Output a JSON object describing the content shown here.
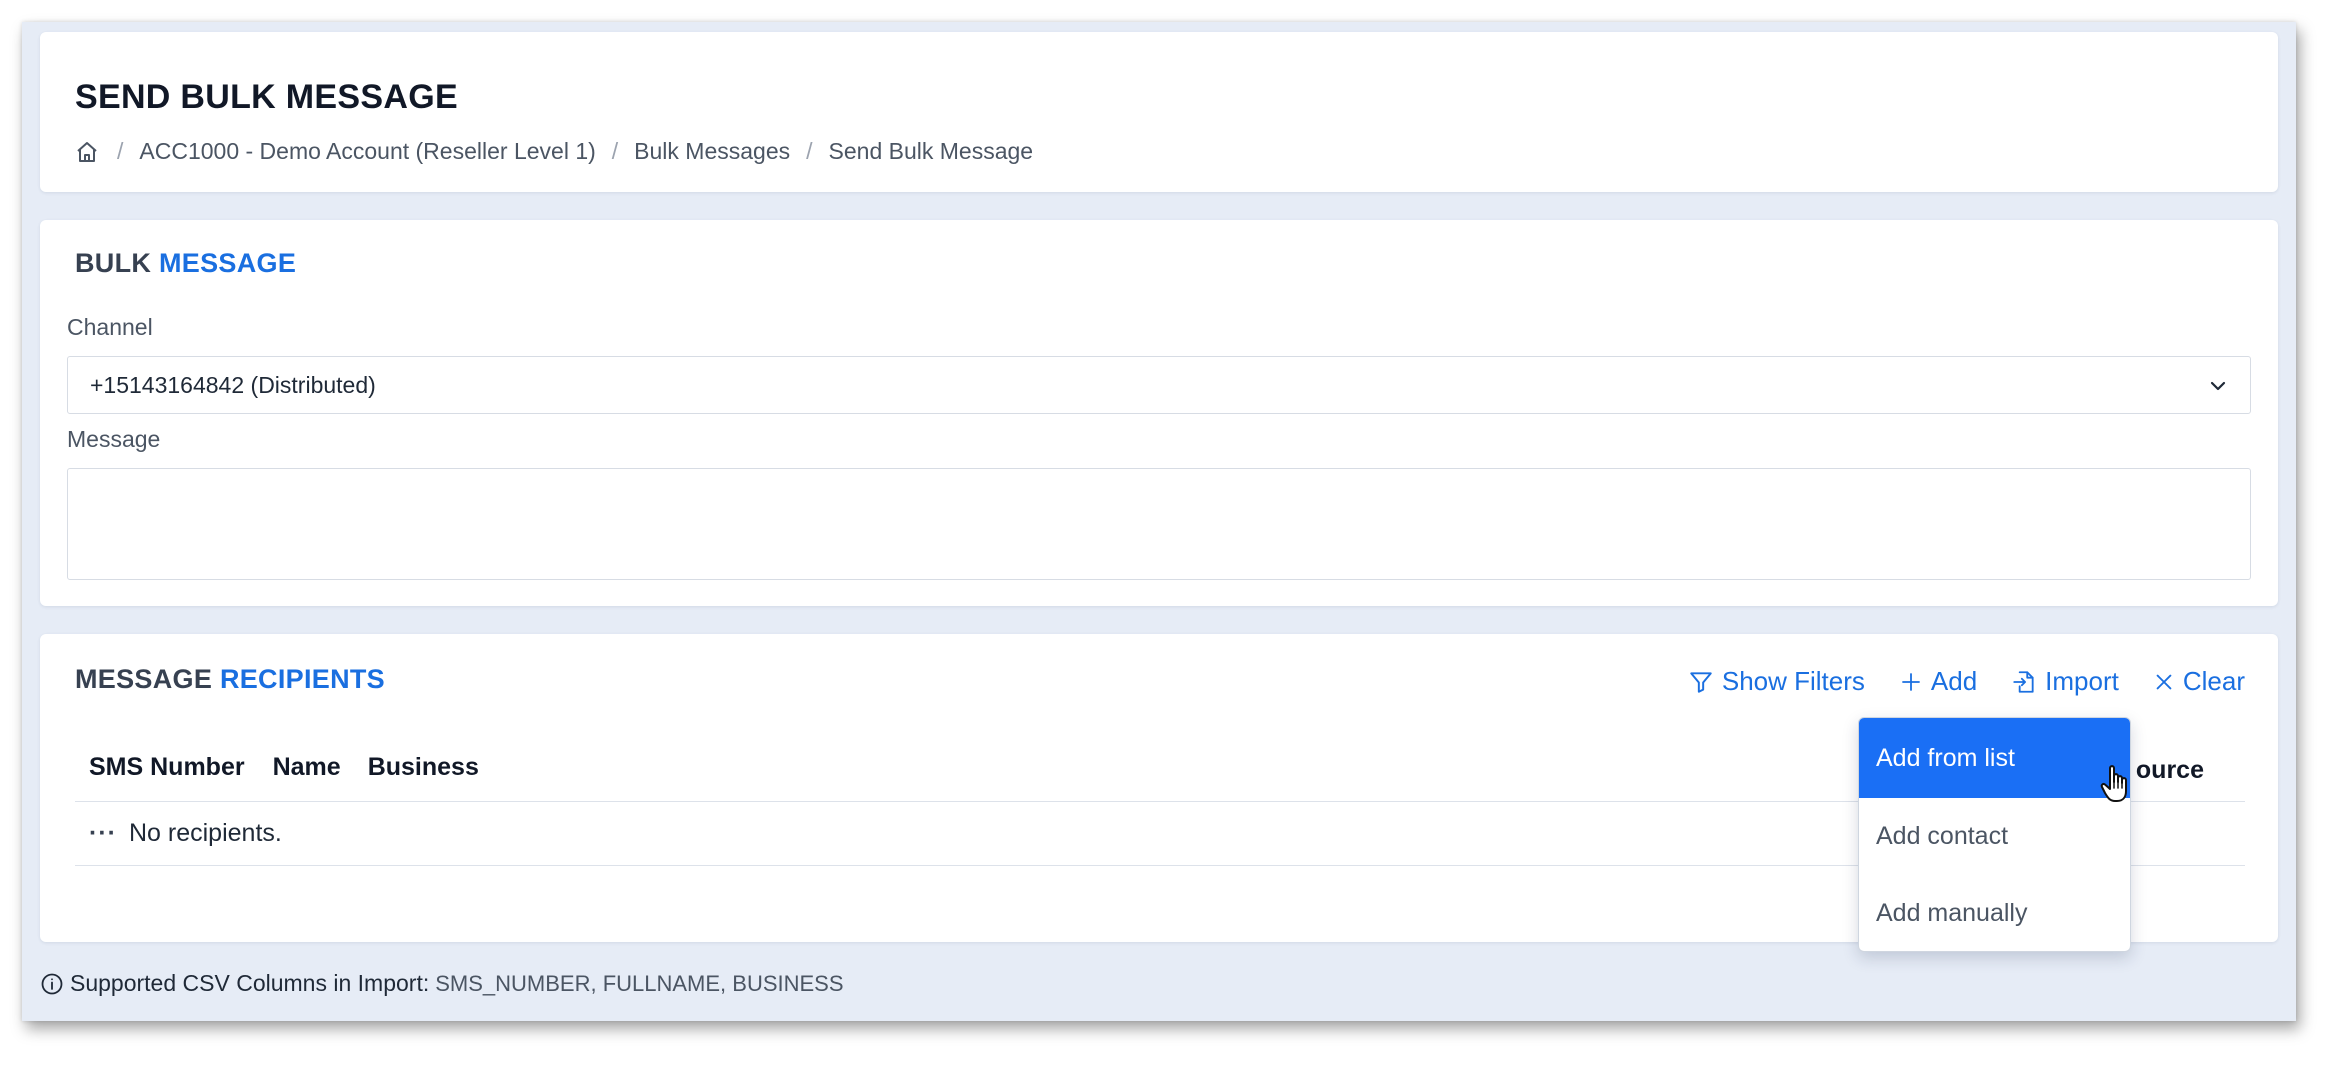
{
  "header": {
    "title": "SEND BULK MESSAGE",
    "breadcrumb": [
      "ACC1000 - Demo Account (Reseller Level 1)",
      "Bulk Messages",
      "Send Bulk Message"
    ]
  },
  "bulk_message": {
    "title_part1": "BULK",
    "title_part2": "MESSAGE",
    "channel_label": "Channel",
    "channel_value": "+15143164842 (Distributed)",
    "message_label": "Message",
    "message_value": ""
  },
  "recipients": {
    "title_part1": "MESSAGE",
    "title_part2": "RECIPIENTS",
    "toolbar": {
      "show_filters": "Show Filters",
      "add": "Add",
      "import": "Import",
      "clear": "Clear"
    },
    "columns": [
      "SMS Number",
      "Name",
      "Business",
      "ource"
    ],
    "empty_menu": "···",
    "empty_text": "No recipients."
  },
  "add_menu": {
    "items": [
      "Add from list",
      "Add contact",
      "Add manually"
    ],
    "active_index": 0
  },
  "footnote": {
    "label": "Supported CSV Columns in Import:",
    "columns": "SMS_NUMBER, FULLNAME, BUSINESS"
  },
  "colors": {
    "accent": "#1a6fe0",
    "menu_active": "#1a6ff5",
    "background": "#e6ecf6"
  }
}
